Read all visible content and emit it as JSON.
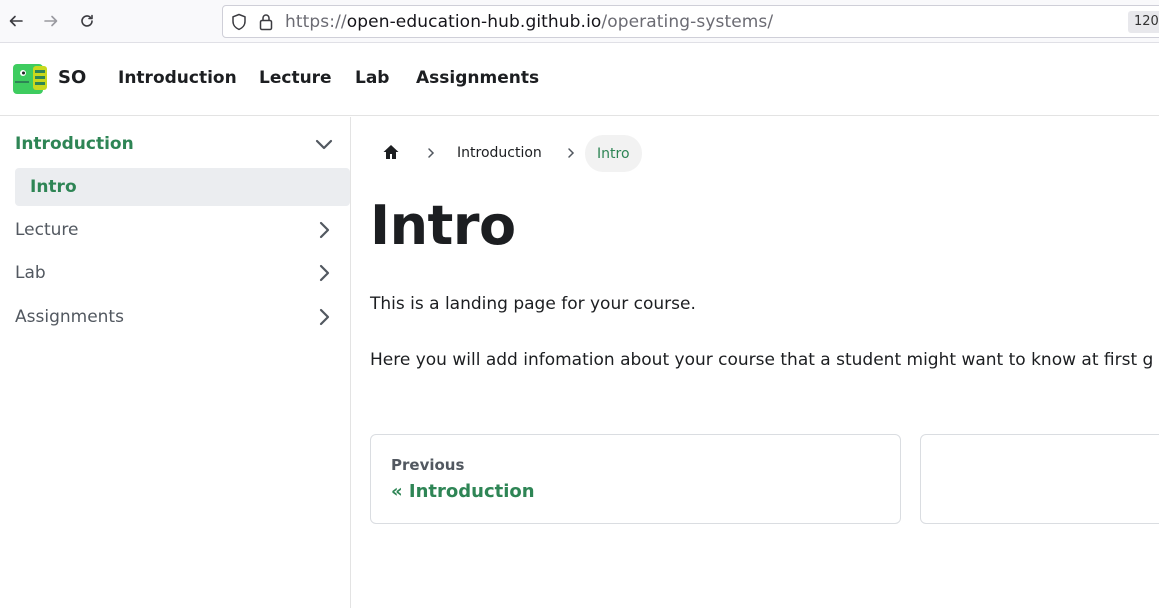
{
  "browser": {
    "url_scheme": "https://",
    "url_host": "open-education-hub.github.io",
    "url_path": "/operating-systems/",
    "zoom": "120"
  },
  "navbar": {
    "brand": "SO",
    "links": [
      "Introduction",
      "Lecture",
      "Lab",
      "Assignments"
    ]
  },
  "sidebar": {
    "items": [
      {
        "label": "Introduction",
        "expanded": true
      },
      {
        "label": "Intro"
      },
      {
        "label": "Lecture"
      },
      {
        "label": "Lab"
      },
      {
        "label": "Assignments"
      }
    ]
  },
  "breadcrumbs": {
    "items": [
      "Introduction",
      "Intro"
    ]
  },
  "content": {
    "title": "Intro",
    "paragraphs": [
      "This is a landing page for your course.",
      "Here you will add infomation about your course that a student might want to know at first g"
    ]
  },
  "pager": {
    "previous_sub": "Previous",
    "previous_label": "« Introduction"
  },
  "colors": {
    "accent": "#2e8555",
    "text": "#1c1e21"
  }
}
